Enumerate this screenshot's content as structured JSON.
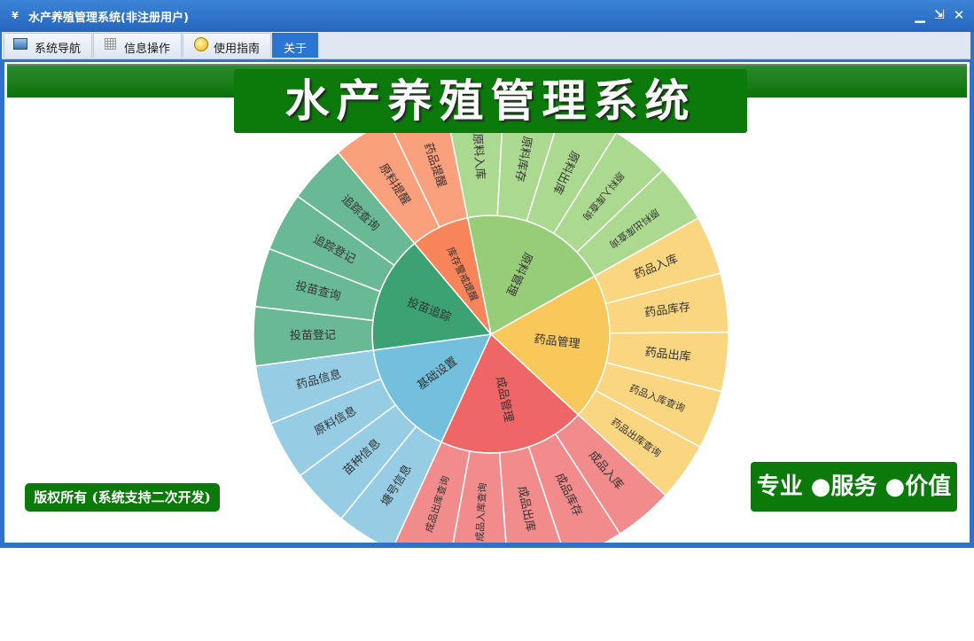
{
  "window": {
    "title": "水产养殖管理系统(非注册用户)",
    "icon": "app-logo-icon",
    "controls": [
      "minimize-icon",
      "restore-icon",
      "close-icon"
    ]
  },
  "menu": {
    "tabs": [
      {
        "label": "系统导航",
        "icon": "monitor-icon",
        "active": false
      },
      {
        "label": "信息操作",
        "icon": "grid-icon",
        "active": false
      },
      {
        "label": "使用指南",
        "icon": "guide-icon",
        "active": false
      },
      {
        "label": "关于",
        "active": true
      }
    ]
  },
  "content": {
    "headline": "水产养殖管理系统",
    "copyright": "版权所有 (系统支持二次开发)",
    "slogan": "专业 ●服务 ●价值"
  },
  "sunburst": {
    "colors": {
      "yellow_inner": "#f9c85a",
      "yellow_outer": "#fbd681",
      "green_inner": "#97cd78",
      "green_outer": "#aad98f",
      "orange_inner": "#f8845a",
      "orange_outer": "#fba07c",
      "teal_inner": "#3ca273",
      "teal_outer": "#6ab995",
      "blue_inner": "#73c0de",
      "blue_outer": "#96cde5",
      "red_inner": "#ee6666",
      "red_outer": "#f28c8c",
      "border": "#ffffff"
    },
    "groups": [
      {
        "name": "药品管理",
        "color": "yellow",
        "children": [
          "药品入库",
          "药品库存",
          "药品出库",
          "药品入库查询",
          "药品出库查询"
        ]
      },
      {
        "name": "成品管理",
        "color": "red",
        "children": [
          "成品入库",
          "成品库存",
          "成品出库",
          "成品入库查询",
          "成品出库查询"
        ]
      },
      {
        "name": "基础设置",
        "color": "blue",
        "children": [
          "塘号信息",
          "苗种信息",
          "原料信息",
          "药品信息"
        ]
      },
      {
        "name": "投苗追踪",
        "color": "teal",
        "children": [
          "投苗登记",
          "投苗查询",
          "追踪登记",
          "追踪查询"
        ]
      },
      {
        "name": "库存警戒提醒",
        "color": "orange",
        "children": [
          "原料提醒",
          "药品提醒"
        ]
      },
      {
        "name": "原料管理",
        "color": "green",
        "children": [
          "原料入库",
          "原料库存",
          "原料出库",
          "原料入库查询",
          "原料出库查询"
        ]
      }
    ]
  }
}
